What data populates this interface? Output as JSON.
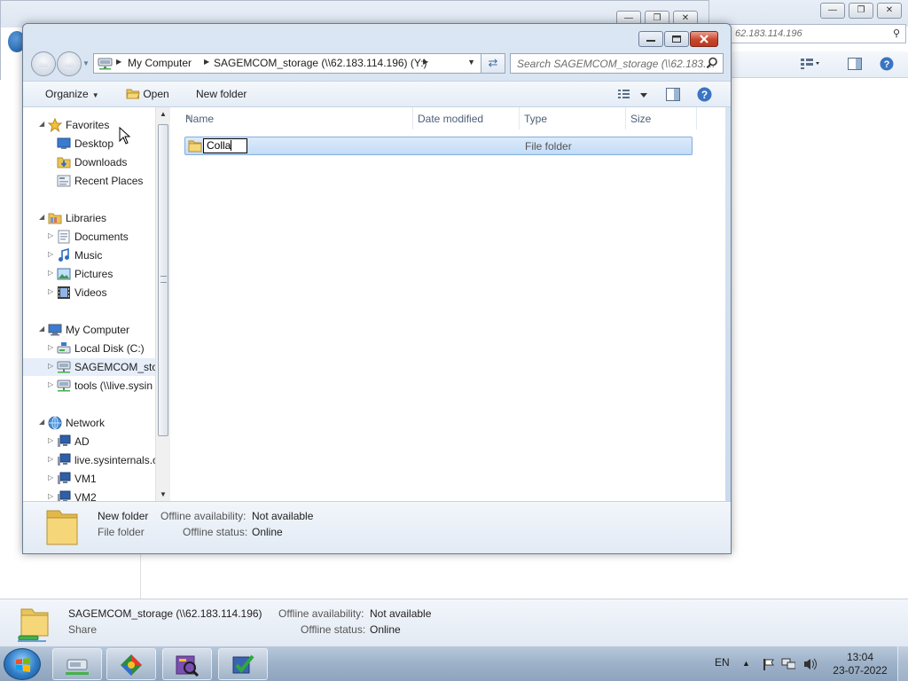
{
  "background_window": {
    "address_partial": "62.183.114.196",
    "details": {
      "name": "SAGEMCOM_storage (\\\\62.183.114.196)",
      "sub": "Share",
      "offline_availability_label": "Offline availability:",
      "offline_availability_value": "Not available",
      "offline_status_label": "Offline status:",
      "offline_status_value": "Online"
    }
  },
  "dialog": {
    "address": {
      "crumbs": [
        "My Computer",
        "SAGEMCOM_storage (\\\\62.183.114.196) (Y:)"
      ]
    },
    "search_placeholder": "Search SAGEMCOM_storage (\\\\62.183....",
    "toolbar": {
      "organize": "Organize",
      "open": "Open",
      "new_folder": "New folder"
    },
    "nav_tree": [
      {
        "label": "Favorites",
        "level": 0,
        "expander": "open",
        "icon": "star-icon"
      },
      {
        "label": "Desktop",
        "level": 1,
        "icon": "desktop-icon"
      },
      {
        "label": "Downloads",
        "level": 1,
        "icon": "downloads-folder-icon"
      },
      {
        "label": "Recent Places",
        "level": 1,
        "icon": "recent-places-icon"
      },
      {
        "label": "Libraries",
        "level": 0,
        "expander": "open",
        "icon": "libraries-icon"
      },
      {
        "label": "Documents",
        "level": 1,
        "expander": "closed",
        "icon": "documents-icon"
      },
      {
        "label": "Music",
        "level": 1,
        "expander": "closed",
        "icon": "music-icon"
      },
      {
        "label": "Pictures",
        "level": 1,
        "expander": "closed",
        "icon": "pictures-icon"
      },
      {
        "label": "Videos",
        "level": 1,
        "expander": "closed",
        "icon": "videos-icon"
      },
      {
        "label": "My Computer",
        "level": 0,
        "expander": "open",
        "icon": "computer-icon"
      },
      {
        "label": "Local Disk (C:)",
        "level": 1,
        "expander": "closed",
        "icon": "drive-icon"
      },
      {
        "label": "SAGEMCOM_sto",
        "level": 1,
        "expander": "closed",
        "icon": "network-drive-icon",
        "selected": true
      },
      {
        "label": "tools (\\\\live.sysin",
        "level": 1,
        "expander": "closed",
        "icon": "network-drive-icon"
      },
      {
        "label": "Network",
        "level": 0,
        "expander": "open",
        "icon": "network-icon"
      },
      {
        "label": "AD",
        "level": 1,
        "expander": "closed",
        "icon": "network-computer-icon"
      },
      {
        "label": "live.sysinternals.c",
        "level": 1,
        "expander": "closed",
        "icon": "network-computer-icon"
      },
      {
        "label": "VM1",
        "level": 1,
        "expander": "closed",
        "icon": "network-computer-icon"
      },
      {
        "label": "VM2",
        "level": 1,
        "expander": "closed",
        "icon": "network-computer-icon"
      }
    ],
    "columns": [
      "Name",
      "Date modified",
      "Type",
      "Size"
    ],
    "files": [
      {
        "name_edit": "Colla",
        "date_modified": "",
        "type": "File folder",
        "size": ""
      }
    ],
    "details": {
      "name": "New folder",
      "sub": "File folder",
      "offline_availability_label": "Offline availability:",
      "offline_availability_value": "Not available",
      "offline_status_label": "Offline status:",
      "offline_status_value": "Online"
    }
  },
  "taskbar": {
    "language": "EN",
    "time": "13:04",
    "date": "23-07-2022"
  },
  "colors": {
    "selection": "#c3dcf7",
    "close_button": "#c8452b",
    "chrome": "#c9d9ec"
  }
}
